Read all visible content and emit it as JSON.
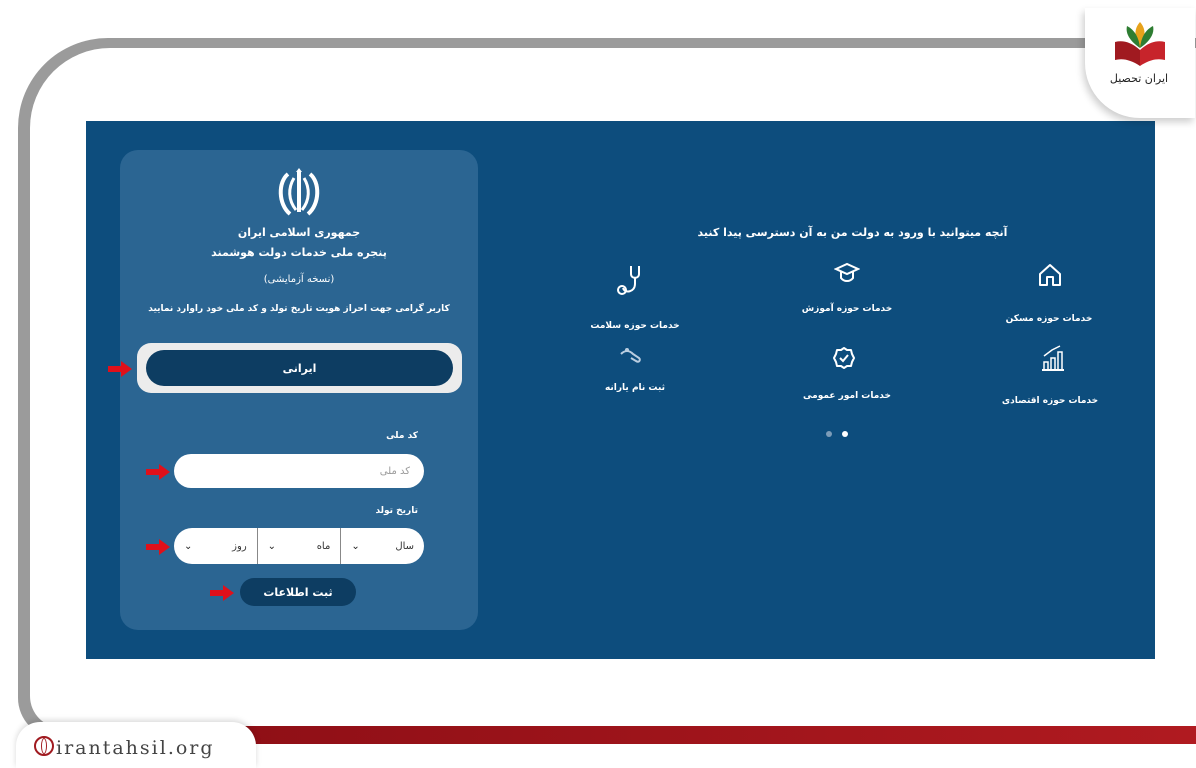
{
  "brand": {
    "name": "ایران تحصیل",
    "watermark": "irantahsil.org"
  },
  "login": {
    "line1": "جمهوری اسلامی ایران",
    "line2": "پنجره ملی خدمات دولت هوشمند",
    "version": "(نسخه آزمایشی)",
    "instruction": "کاربر گرامی جهت احراز هویت تاریخ تولد و کد ملی خود راوارد نمایید",
    "citizen_label": "ایرانی",
    "national_code_label": "کد ملی",
    "national_code_placeholder": "کد ملی",
    "birth_date_label": "تاریخ تولد",
    "year": "سال",
    "month": "ماه",
    "day": "روز",
    "submit": "ثبت اطلاعات"
  },
  "services": {
    "heading": "آنچه میتوانید با ورود به دولت من به آن دسترسی پیدا کنید",
    "items": [
      {
        "label": "خدمات حوزه مسکن",
        "icon": "home-icon"
      },
      {
        "label": "خدمات حوزه آموزش",
        "icon": "graduation-cap-icon"
      },
      {
        "label": "خدمات حوزه سلامت",
        "icon": "stethoscope-icon"
      },
      {
        "label": "خدمات حوزه اقتصادی",
        "icon": "chart-icon"
      },
      {
        "label": "خدمات امور عمومی",
        "icon": "badge-check-icon"
      },
      {
        "label": "ثبت نام یارانه",
        "icon": "hand-icon"
      }
    ]
  },
  "colors": {
    "background": "#0d4d7d",
    "card": "#2b6592",
    "button": "#0d3d62",
    "arrow": "#e0101a"
  }
}
